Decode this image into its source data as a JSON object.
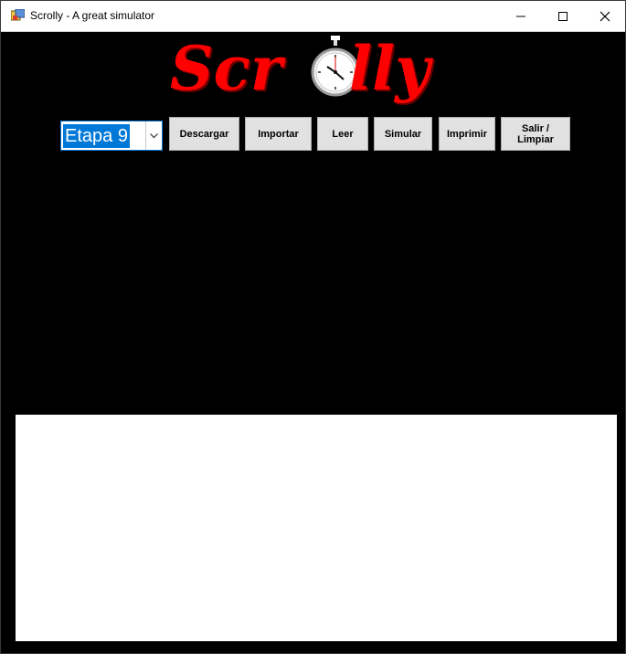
{
  "window": {
    "title": "Scrolly - A great simulator"
  },
  "logo": {
    "left_text": "Scr",
    "right_text": "lly"
  },
  "toolbar": {
    "stage_value": "Etapa 9",
    "descargar": "Descargar",
    "importar": "Importar",
    "leer": "Leer",
    "simular": "Simular",
    "imprimir": "Imprimir",
    "salir_line1": "Salir /",
    "salir_line2": "Limpiar"
  },
  "colors": {
    "background": "#000000",
    "logo_red": "#ff0000",
    "selection_blue": "#0078d7",
    "button_face": "#e1e1e1"
  },
  "icons": [
    "app-icon",
    "minimize-icon",
    "maximize-icon",
    "close-icon",
    "stopwatch-icon",
    "chevron-down-icon"
  ]
}
